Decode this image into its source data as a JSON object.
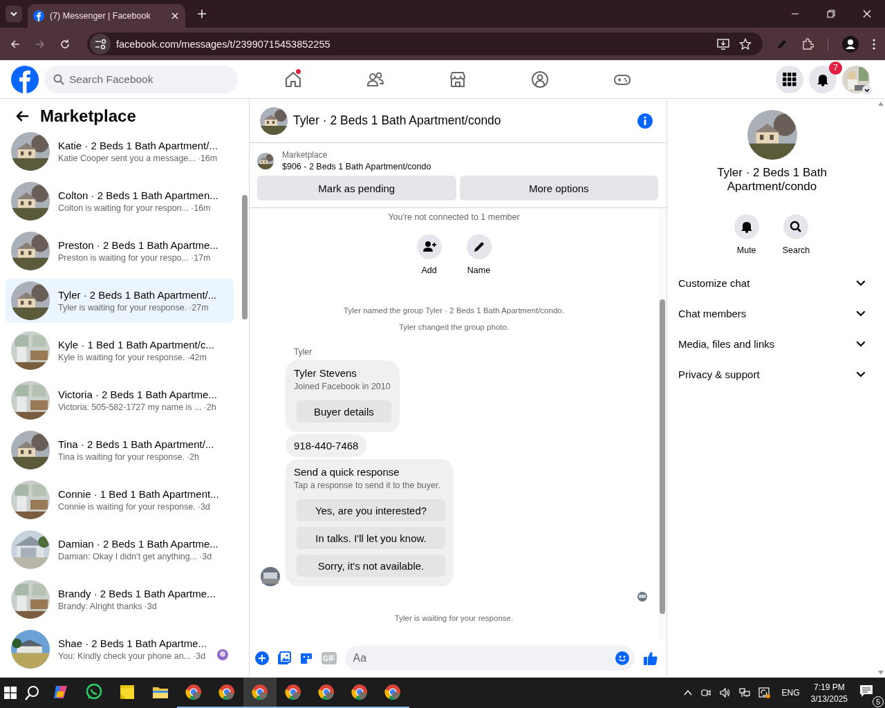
{
  "browser": {
    "tab_title": "(7) Messenger | Facebook",
    "url": "facebook.com/messages/t/23990715453852255"
  },
  "header": {
    "search_placeholder": "Search Facebook",
    "notification_count": "7",
    "nav": [
      {
        "kind": "home",
        "dot": true
      },
      {
        "kind": "friends",
        "dot": false
      },
      {
        "kind": "marketplace",
        "dot": false
      },
      {
        "kind": "groups",
        "dot": false
      },
      {
        "kind": "gaming",
        "dot": false
      }
    ]
  },
  "sidebar": {
    "title": "Marketplace",
    "conversations": [
      {
        "title": "Katie · 2 Beds 1 Bath Apartment/...",
        "preview": "Katie Cooper sent you a message...",
        "time": "·16m",
        "selected": false,
        "seen": false
      },
      {
        "title": "Colton · 2 Beds 1 Bath Apartmen...",
        "preview": "Colton is waiting for your respon...",
        "time": "·16m",
        "selected": false,
        "seen": false
      },
      {
        "title": "Preston · 2 Beds 1 Bath Apartme...",
        "preview": "Preston is waiting for your respo...",
        "time": "·17m",
        "selected": false,
        "seen": false
      },
      {
        "title": "Tyler · 2 Beds 1 Bath Apartment/...",
        "preview": "Tyler is waiting for your response.",
        "time": "·27m",
        "selected": true,
        "seen": false
      },
      {
        "title": "Kyle · 1 Bed 1 Bath Apartment/c...",
        "preview": "Kyle is waiting for your response.",
        "time": "·42m",
        "selected": false,
        "seen": false
      },
      {
        "title": "Victoria · 2 Beds 1 Bath Apartme...",
        "preview": "Victoria: 505-582-1727 my name is ...",
        "time": "·2h",
        "selected": false,
        "seen": false
      },
      {
        "title": "Tina · 2 Beds 1 Bath Apartment/...",
        "preview": "Tina is waiting for your response.",
        "time": "·2h",
        "selected": false,
        "seen": false
      },
      {
        "title": "Connie · 1 Bed 1 Bath Apartment...",
        "preview": "Connie is waiting for your response.",
        "time": "·3d",
        "selected": false,
        "seen": false
      },
      {
        "title": "Damian · 2 Beds 1 Bath Apartme...",
        "preview": "Damian: Okay I didn't get anything...",
        "time": "·3d",
        "selected": false,
        "seen": false
      },
      {
        "title": "Brandy · 2 Beds 1 Bath Apartme...",
        "preview": "Brandy: Alright thanks",
        "time": "·3d",
        "selected": false,
        "seen": false
      },
      {
        "title": "Shae · 2 Beds 1 Bath Apartme...",
        "preview": "You: Kindly check your phone an...",
        "time": "·3d",
        "selected": false,
        "seen": true
      }
    ]
  },
  "chat": {
    "title": "Tyler · 2 Beds 1 Bath Apartment/condo",
    "listing": {
      "label": "Marketplace",
      "text": "$906 - 2 Beds 1 Bath Apartment/condo",
      "buttons": [
        "Mark as pending",
        "More options"
      ]
    },
    "notice": "You're not connected to 1 member",
    "actions": [
      {
        "kind": "add",
        "label": "Add"
      },
      {
        "kind": "name",
        "label": "Name"
      }
    ],
    "events": [
      "Tyler named the group Tyler · 2 Beds 1 Bath Apartment/condo.",
      "Tyler changed the group photo."
    ],
    "sender": "Tyler",
    "profile_card": {
      "name": "Tyler Stevens",
      "joined": "Joined Facebook in 2010",
      "button": "Buyer details"
    },
    "message": "918-440-7468",
    "quick_response": {
      "title": "Send a quick response",
      "subtitle": "Tap a response to send it to the buyer.",
      "options": [
        "Yes, are you interested?",
        "In talks. I'll let you know.",
        "Sorry, it's not available."
      ]
    },
    "status": "Tyler is waiting for your response.",
    "composer": {
      "placeholder": "Aa",
      "gif": "GIF"
    }
  },
  "details": {
    "title": "Tyler · 2 Beds 1 Bath Apartment/condo",
    "actions": [
      {
        "kind": "mute",
        "label": "Mute"
      },
      {
        "kind": "search",
        "label": "Search"
      }
    ],
    "sections": [
      {
        "label": "Customize chat",
        "expanded": false
      },
      {
        "label": "Chat members",
        "expanded": false
      },
      {
        "label": "Media, files and links",
        "expanded": false
      },
      {
        "label": "Privacy & support",
        "expanded": false
      }
    ]
  },
  "taskbar": {
    "apps": [
      {
        "kind": "copilot",
        "selected": false
      },
      {
        "kind": "whatsapp",
        "selected": false
      },
      {
        "kind": "notes",
        "selected": false
      },
      {
        "kind": "folder",
        "selected": false
      },
      {
        "kind": "chrome",
        "selected": false
      },
      {
        "kind": "chrome",
        "selected": false
      },
      {
        "kind": "chrome",
        "selected": true
      },
      {
        "kind": "chrome",
        "selected": false
      },
      {
        "kind": "chrome",
        "selected": false
      },
      {
        "kind": "chrome",
        "selected": false
      },
      {
        "kind": "chrome",
        "selected": false
      }
    ],
    "language": "ENG",
    "time": "7:19 PM",
    "date": "3/13/2025",
    "notification_count": "5"
  }
}
